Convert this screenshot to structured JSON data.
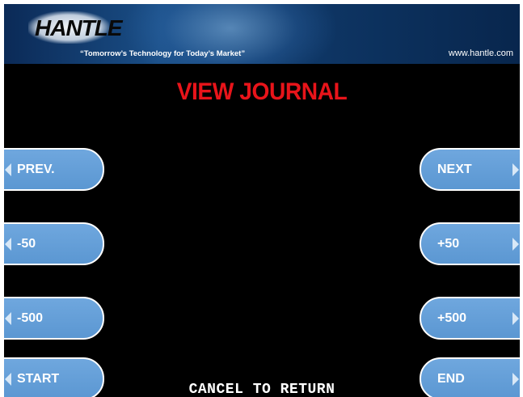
{
  "header": {
    "logo_text": "HANTLE",
    "tagline": "“Tomorrow’s Technology for Today’s Market”",
    "website": "www.hantle.com"
  },
  "title": "VIEW JOURNAL",
  "left_buttons": [
    {
      "label": "PREV."
    },
    {
      "label": "-50"
    },
    {
      "label": "-500"
    },
    {
      "label": "START"
    }
  ],
  "right_buttons": [
    {
      "label": "NEXT"
    },
    {
      "label": "+50"
    },
    {
      "label": "+500"
    },
    {
      "label": "END"
    }
  ],
  "footer": {
    "cancel_label": "CANCEL TO RETURN"
  },
  "colors": {
    "title": "#e8141a",
    "button": "#5b97d2",
    "background": "#000000",
    "header": "#0f3868"
  }
}
